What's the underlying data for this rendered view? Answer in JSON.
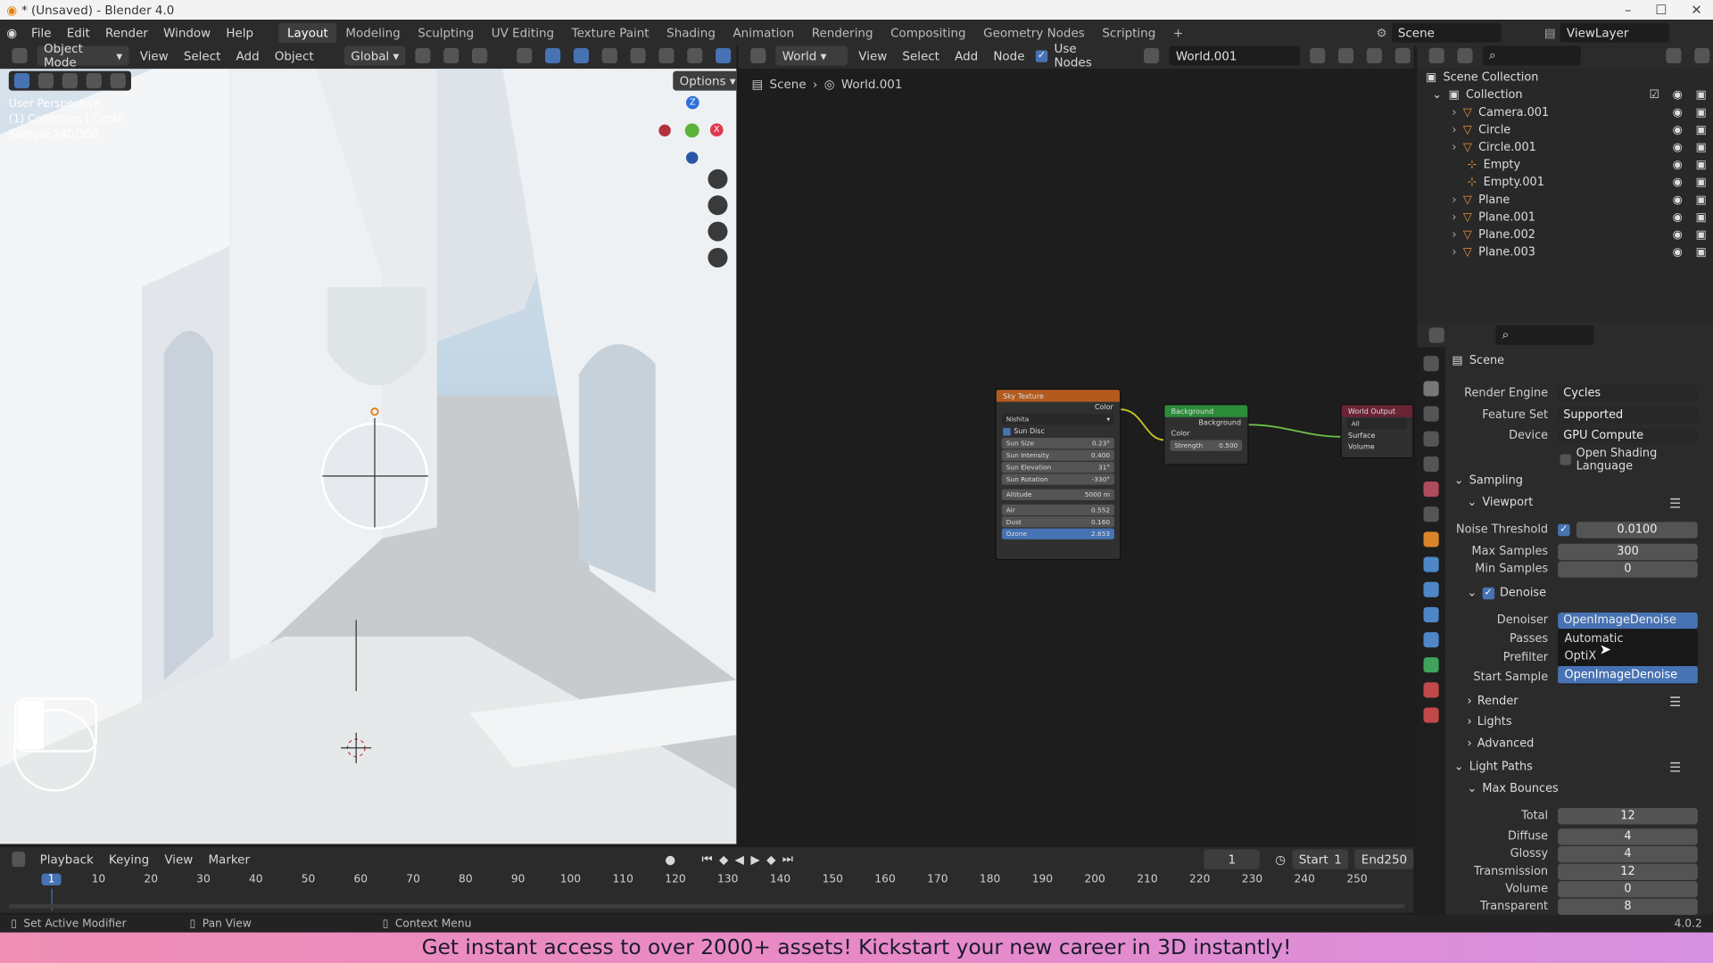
{
  "window": {
    "title": "* (Unsaved) - Blender 4.0",
    "minimize": "–",
    "maximize": "☐",
    "close": "✕"
  },
  "menu": [
    "File",
    "Edit",
    "Render",
    "Window",
    "Help"
  ],
  "workspaces": [
    "Layout",
    "Modeling",
    "Sculpting",
    "UV Editing",
    "Texture Paint",
    "Shading",
    "Animation",
    "Rendering",
    "Compositing",
    "Geometry Nodes",
    "Scripting"
  ],
  "active_workspace": "Layout",
  "add_tab": "+",
  "scene_field": "Scene",
  "viewlayer_field": "ViewLayer",
  "viewport": {
    "mode": "Object Mode",
    "menus": [
      "View",
      "Select",
      "Add",
      "Object"
    ],
    "transform": "Global",
    "options": "Options",
    "info": [
      "User Perspective",
      "(1) Collection | Circle",
      "Sample 240/300"
    ],
    "gizmo": {
      "z": "Z",
      "x": "X",
      "y": "Y"
    }
  },
  "node_editor": {
    "type": "World",
    "menus": [
      "View",
      "Select",
      "Add",
      "Node"
    ],
    "use_nodes": "Use Nodes",
    "world_name": "World.001",
    "breadcrumb": [
      "Scene",
      "World.001"
    ],
    "sky": {
      "title": "Sky Texture",
      "color_out": "Color",
      "type": "Nishita",
      "sun_disc": "Sun Disc",
      "fields": [
        {
          "l": "Sun Size",
          "v": "0.23°"
        },
        {
          "l": "Sun Intensity",
          "v": "0.400"
        },
        {
          "l": "Sun Elevation",
          "v": "31°"
        },
        {
          "l": "Sun Rotation",
          "v": "-330°"
        },
        {
          "l": "Altitude",
          "v": "5000 m"
        },
        {
          "l": "Air",
          "v": "0.552"
        },
        {
          "l": "Dust",
          "v": "0.160"
        },
        {
          "l": "Ozone",
          "v": "2.653"
        }
      ]
    },
    "background": {
      "title": "Background",
      "out": "Background",
      "color": "Color",
      "strength_label": "Strength",
      "strength": "0.500"
    },
    "output": {
      "title": "World Output",
      "target": "All",
      "surface": "Surface",
      "volume": "Volume"
    }
  },
  "outliner": {
    "root": "Scene Collection",
    "collection": "Collection",
    "items": [
      "Camera.001",
      "Circle",
      "Circle.001",
      "Empty",
      "Empty.001",
      "Plane",
      "Plane.001",
      "Plane.002",
      "Plane.003"
    ]
  },
  "properties": {
    "context": "Scene",
    "render_engine": {
      "label": "Render Engine",
      "value": "Cycles"
    },
    "feature_set": {
      "label": "Feature Set",
      "value": "Supported"
    },
    "device": {
      "label": "Device",
      "value": "GPU Compute"
    },
    "osl": "Open Shading Language",
    "sampling": "Sampling",
    "viewport_panel": "Viewport",
    "noise_threshold": {
      "label": "Noise Threshold",
      "value": "0.0100"
    },
    "max_samples": {
      "label": "Max Samples",
      "value": "300"
    },
    "min_samples": {
      "label": "Min Samples",
      "value": "0"
    },
    "denoise": "Denoise",
    "denoiser": {
      "label": "Denoiser",
      "value": "OpenImageDenoise"
    },
    "passes_label": "Passes",
    "prefilter_label": "Prefilter",
    "start_sample_label": "Start Sample",
    "dropdown": [
      "Automatic",
      "OptiX",
      "OpenImageDenoise"
    ],
    "render_panel": "Render",
    "lights_panel": "Lights",
    "advanced_panel": "Advanced",
    "light_paths": "Light Paths",
    "max_bounces": "Max Bounces",
    "bounces": [
      {
        "l": "Total",
        "v": "12"
      },
      {
        "l": "Diffuse",
        "v": "4"
      },
      {
        "l": "Glossy",
        "v": "4"
      },
      {
        "l": "Transmission",
        "v": "12"
      },
      {
        "l": "Volume",
        "v": "0"
      },
      {
        "l": "Transparent",
        "v": "8"
      }
    ]
  },
  "timeline": {
    "menus": [
      "Playback",
      "Keying",
      "View",
      "Marker"
    ],
    "current": "1",
    "start_label": "Start",
    "start": "1",
    "end_label": "End",
    "end": "250",
    "ticks": [
      "1",
      "10",
      "20",
      "30",
      "40",
      "50",
      "60",
      "70",
      "80",
      "90",
      "100",
      "110",
      "120",
      "130",
      "140",
      "150",
      "160",
      "170",
      "180",
      "190",
      "200",
      "210",
      "220",
      "230",
      "240",
      "250"
    ]
  },
  "status": {
    "items": [
      "Set Active Modifier",
      "Pan View",
      "Context Menu"
    ],
    "version": "4.0.2"
  },
  "banner": "Get instant access to over 2000+ assets! Kickstart your new career in 3D instantly!"
}
